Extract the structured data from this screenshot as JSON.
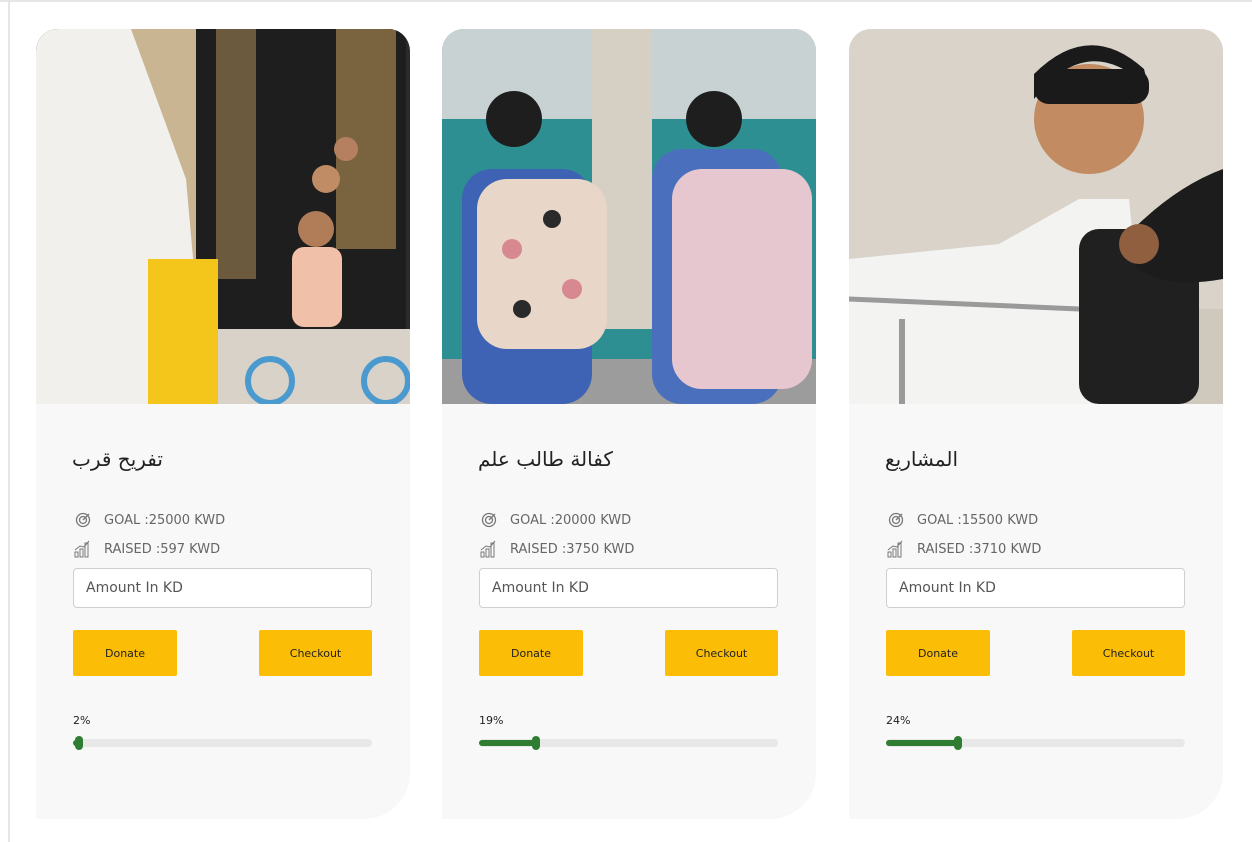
{
  "colors": {
    "button": "#fbbd05",
    "progress": "#2e7d32",
    "track": "#e8e8e8",
    "card": "#f8f8f8"
  },
  "cards": [
    {
      "title": "تفريح قرب",
      "goal": "GOAL :25000 KWD",
      "raised": "RAISED :597 KWD",
      "amount_placeholder": "Amount In KD",
      "donate_label": "Donate",
      "checkout_label": "Checkout",
      "progress_label": "2%",
      "progress": 2,
      "image": "child-on-tricycle-photo"
    },
    {
      "title": "كفالة طالب علم",
      "goal": "GOAL :20000 KWD",
      "raised": "RAISED :3750 KWD",
      "amount_placeholder": "Amount In KD",
      "donate_label": "Donate",
      "checkout_label": "Checkout",
      "progress_label": "19%",
      "progress": 19,
      "image": "schoolgirls-backpacks-photo"
    },
    {
      "title": "المشاريع",
      "goal": "GOAL :15500 KWD",
      "raised": "RAISED :3710 KWD",
      "amount_placeholder": "Amount In KD",
      "donate_label": "Donate",
      "checkout_label": "Checkout",
      "progress_label": "24%",
      "progress": 24,
      "image": "boy-wheelchair-photo"
    }
  ]
}
